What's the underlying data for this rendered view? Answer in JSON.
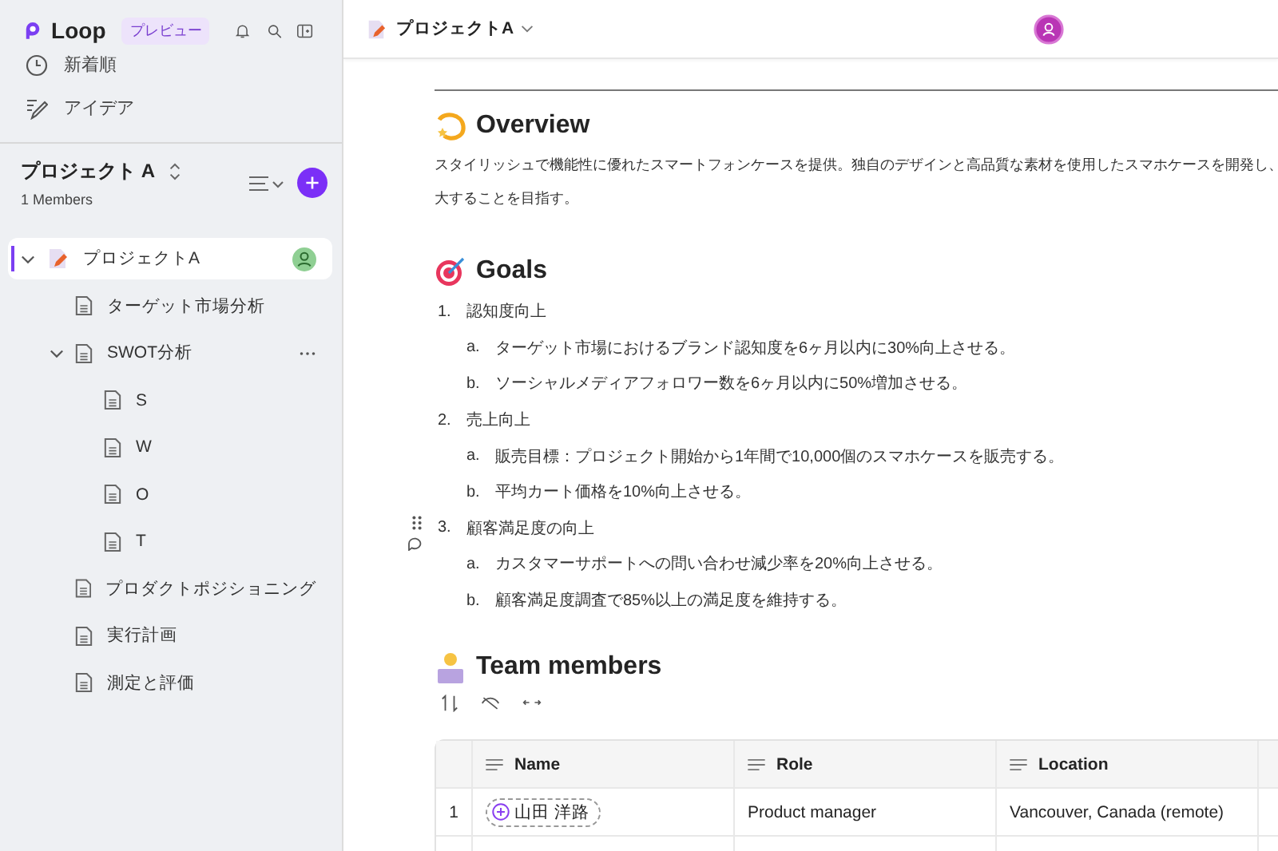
{
  "app": {
    "name": "Loop",
    "badge": "プレビュー"
  },
  "nav": [
    {
      "kind": "recent",
      "label": "新着順"
    },
    {
      "kind": "ideas",
      "label": "アイデア"
    }
  ],
  "workspace": {
    "title": "プロジェクト A",
    "members": "1 Members"
  },
  "tree": [
    {
      "label": "プロジェクトA",
      "kind": "project",
      "selected": true,
      "expanded": true,
      "children": [
        {
          "label": "ターゲット市場分析",
          "kind": "page",
          "selected": false
        },
        {
          "label": "SWOT分析",
          "kind": "page",
          "selected": false,
          "expanded": true,
          "children": [
            {
              "label": "S",
              "kind": "page",
              "selected": false
            },
            {
              "label": "W",
              "kind": "page",
              "selected": false
            },
            {
              "label": "O",
              "kind": "page",
              "selected": false
            },
            {
              "label": "T",
              "kind": "page",
              "selected": false
            }
          ]
        },
        {
          "label": "プロダクトポジショニング",
          "kind": "page",
          "selected": false
        },
        {
          "label": "実行計画",
          "kind": "page",
          "selected": false
        },
        {
          "label": "測定と評価",
          "kind": "page",
          "selected": false
        }
      ]
    }
  ],
  "header": {
    "title": "プロジェクトA"
  },
  "sections": [
    {
      "kind": "text",
      "heading": "Overview",
      "lines": [
        "スタイリッシュで機能性に優れたスマートフォンケースを提供。独自のデザインと高品質な素材を使用したスマホケースを開発し、",
        "大することを目指す。"
      ]
    },
    {
      "kind": "list",
      "heading": "Goals",
      "items": [
        {
          "marker": "1.",
          "text": "認知度向上",
          "children": [
            {
              "marker": "a.",
              "text": "ターゲット市場におけるブランド認知度を6ヶ月以内に30%向上させる。"
            },
            {
              "marker": "b.",
              "text": "ソーシャルメディアフォロワー数を6ヶ月以内に50%増加させる。"
            }
          ]
        },
        {
          "marker": "2.",
          "text": "売上向上",
          "children": [
            {
              "marker": "a.",
              "text": "販売目標：プロジェクト開始から1年間で10,000個のスマホケースを販売する。"
            },
            {
              "marker": "b.",
              "text": "平均カート価格を10%向上させる。"
            }
          ]
        },
        {
          "marker": "3.",
          "text": "顧客満足度の向上",
          "children": [
            {
              "marker": "a.",
              "text": "カスタマーサポートへの問い合わせ減少率を20%向上させる。"
            },
            {
              "marker": "b.",
              "text": "顧客満足度調査で85%以上の満足度を維持する。"
            }
          ]
        }
      ]
    },
    {
      "kind": "table",
      "heading": "Team members",
      "columns": [
        "Name",
        "Role",
        "Location"
      ],
      "rows": [
        {
          "number": "1",
          "cells": [
            {
              "kind": "person",
              "text": "山田 洋路"
            },
            {
              "kind": "text",
              "text": "Product manager"
            },
            {
              "kind": "text",
              "text": "Vancouver, Canada (remote)"
            }
          ]
        }
      ]
    }
  ]
}
